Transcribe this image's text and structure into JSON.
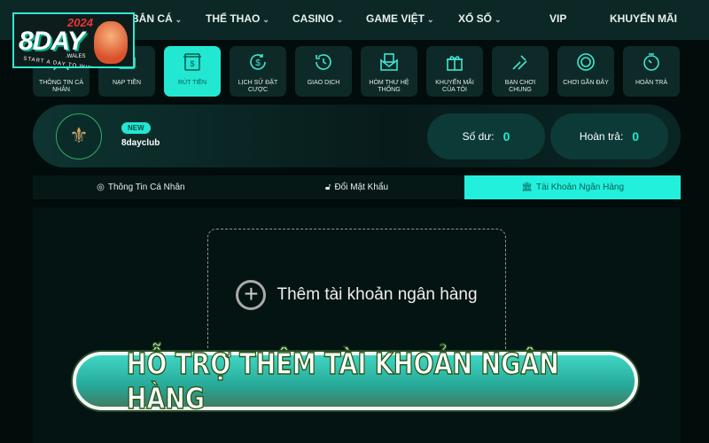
{
  "logo": {
    "text": "8DAY",
    "year": "2024",
    "sub": ".WALES",
    "tagline": "START A DAY TO WIN"
  },
  "nav": {
    "items": [
      {
        "label": "BẮN CÁ",
        "dropdown": true
      },
      {
        "label": "THỂ THAO",
        "dropdown": true
      },
      {
        "label": "CASINO",
        "dropdown": true
      },
      {
        "label": "GAME VIỆT",
        "dropdown": true
      },
      {
        "label": "XỔ SỐ",
        "dropdown": true
      },
      {
        "label": "VIP",
        "dropdown": false
      },
      {
        "label": "KHUYẾN MÃI",
        "dropdown": false
      }
    ]
  },
  "tiles": [
    {
      "label": "THÔNG TIN CÁ NHÂN",
      "icon": "user-icon"
    },
    {
      "label": "NẠP TIỀN",
      "icon": "wallet-icon"
    },
    {
      "label": "RÚT TIỀN",
      "icon": "atm-icon",
      "active": true
    },
    {
      "label": "LỊCH SỬ ĐẶT CƯỢC",
      "icon": "dollar-refresh-icon"
    },
    {
      "label": "GIAO DỊCH",
      "icon": "history-icon"
    },
    {
      "label": "HÒM THƯ HỆ THỐNG",
      "icon": "mail-icon"
    },
    {
      "label": "KHUYẾN MÃI CỦA TÔI",
      "icon": "gift-icon"
    },
    {
      "label": "BẠN CHƠI CHUNG",
      "icon": "handshake-icon"
    },
    {
      "label": "CHƠI GẦN ĐÂY",
      "icon": "chip-icon"
    },
    {
      "label": "HOÀN TRẢ",
      "icon": "stopwatch-icon"
    }
  ],
  "profile": {
    "badge": "NEW",
    "username": "8dayclub",
    "balance_label": "Số dư:",
    "balance": "0",
    "rebate_label": "Hoàn trả:",
    "rebate": "0"
  },
  "tabs": [
    {
      "label": "Thông Tin Cá Nhân",
      "icon": "user-circle-icon"
    },
    {
      "label": "Đổi Mật Khẩu",
      "icon": "lock-icon"
    },
    {
      "label": "Tài Khoản Ngân Hàng",
      "icon": "bank-icon",
      "active": true
    }
  ],
  "add_bank": {
    "label": "Thêm tài khoản ngân hàng"
  },
  "banner": {
    "text": "HỖ TRỢ THÊM TÀI KHOẢN NGÂN HÀNG"
  },
  "colors": {
    "accent": "#22e8d2",
    "nav_bg": "#0c2826",
    "page_bg": "#020c0b"
  }
}
